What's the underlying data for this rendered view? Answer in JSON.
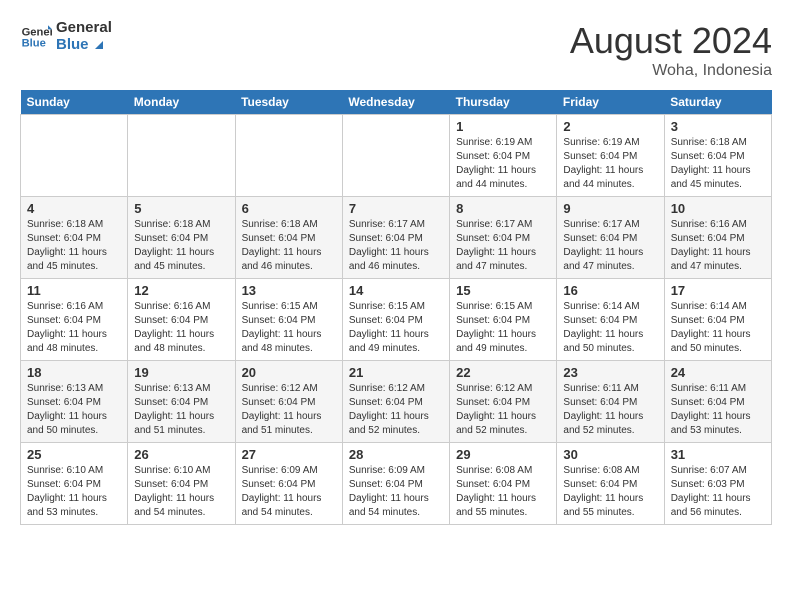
{
  "header": {
    "logo_line1": "General",
    "logo_line2": "Blue",
    "month": "August 2024",
    "location": "Woha, Indonesia"
  },
  "weekdays": [
    "Sunday",
    "Monday",
    "Tuesday",
    "Wednesday",
    "Thursday",
    "Friday",
    "Saturday"
  ],
  "weeks": [
    [
      {
        "day": "",
        "info": ""
      },
      {
        "day": "",
        "info": ""
      },
      {
        "day": "",
        "info": ""
      },
      {
        "day": "",
        "info": ""
      },
      {
        "day": "1",
        "info": "Sunrise: 6:19 AM\nSunset: 6:04 PM\nDaylight: 11 hours\nand 44 minutes."
      },
      {
        "day": "2",
        "info": "Sunrise: 6:19 AM\nSunset: 6:04 PM\nDaylight: 11 hours\nand 44 minutes."
      },
      {
        "day": "3",
        "info": "Sunrise: 6:18 AM\nSunset: 6:04 PM\nDaylight: 11 hours\nand 45 minutes."
      }
    ],
    [
      {
        "day": "4",
        "info": "Sunrise: 6:18 AM\nSunset: 6:04 PM\nDaylight: 11 hours\nand 45 minutes."
      },
      {
        "day": "5",
        "info": "Sunrise: 6:18 AM\nSunset: 6:04 PM\nDaylight: 11 hours\nand 45 minutes."
      },
      {
        "day": "6",
        "info": "Sunrise: 6:18 AM\nSunset: 6:04 PM\nDaylight: 11 hours\nand 46 minutes."
      },
      {
        "day": "7",
        "info": "Sunrise: 6:17 AM\nSunset: 6:04 PM\nDaylight: 11 hours\nand 46 minutes."
      },
      {
        "day": "8",
        "info": "Sunrise: 6:17 AM\nSunset: 6:04 PM\nDaylight: 11 hours\nand 47 minutes."
      },
      {
        "day": "9",
        "info": "Sunrise: 6:17 AM\nSunset: 6:04 PM\nDaylight: 11 hours\nand 47 minutes."
      },
      {
        "day": "10",
        "info": "Sunrise: 6:16 AM\nSunset: 6:04 PM\nDaylight: 11 hours\nand 47 minutes."
      }
    ],
    [
      {
        "day": "11",
        "info": "Sunrise: 6:16 AM\nSunset: 6:04 PM\nDaylight: 11 hours\nand 48 minutes."
      },
      {
        "day": "12",
        "info": "Sunrise: 6:16 AM\nSunset: 6:04 PM\nDaylight: 11 hours\nand 48 minutes."
      },
      {
        "day": "13",
        "info": "Sunrise: 6:15 AM\nSunset: 6:04 PM\nDaylight: 11 hours\nand 48 minutes."
      },
      {
        "day": "14",
        "info": "Sunrise: 6:15 AM\nSunset: 6:04 PM\nDaylight: 11 hours\nand 49 minutes."
      },
      {
        "day": "15",
        "info": "Sunrise: 6:15 AM\nSunset: 6:04 PM\nDaylight: 11 hours\nand 49 minutes."
      },
      {
        "day": "16",
        "info": "Sunrise: 6:14 AM\nSunset: 6:04 PM\nDaylight: 11 hours\nand 50 minutes."
      },
      {
        "day": "17",
        "info": "Sunrise: 6:14 AM\nSunset: 6:04 PM\nDaylight: 11 hours\nand 50 minutes."
      }
    ],
    [
      {
        "day": "18",
        "info": "Sunrise: 6:13 AM\nSunset: 6:04 PM\nDaylight: 11 hours\nand 50 minutes."
      },
      {
        "day": "19",
        "info": "Sunrise: 6:13 AM\nSunset: 6:04 PM\nDaylight: 11 hours\nand 51 minutes."
      },
      {
        "day": "20",
        "info": "Sunrise: 6:12 AM\nSunset: 6:04 PM\nDaylight: 11 hours\nand 51 minutes."
      },
      {
        "day": "21",
        "info": "Sunrise: 6:12 AM\nSunset: 6:04 PM\nDaylight: 11 hours\nand 52 minutes."
      },
      {
        "day": "22",
        "info": "Sunrise: 6:12 AM\nSunset: 6:04 PM\nDaylight: 11 hours\nand 52 minutes."
      },
      {
        "day": "23",
        "info": "Sunrise: 6:11 AM\nSunset: 6:04 PM\nDaylight: 11 hours\nand 52 minutes."
      },
      {
        "day": "24",
        "info": "Sunrise: 6:11 AM\nSunset: 6:04 PM\nDaylight: 11 hours\nand 53 minutes."
      }
    ],
    [
      {
        "day": "25",
        "info": "Sunrise: 6:10 AM\nSunset: 6:04 PM\nDaylight: 11 hours\nand 53 minutes."
      },
      {
        "day": "26",
        "info": "Sunrise: 6:10 AM\nSunset: 6:04 PM\nDaylight: 11 hours\nand 54 minutes."
      },
      {
        "day": "27",
        "info": "Sunrise: 6:09 AM\nSunset: 6:04 PM\nDaylight: 11 hours\nand 54 minutes."
      },
      {
        "day": "28",
        "info": "Sunrise: 6:09 AM\nSunset: 6:04 PM\nDaylight: 11 hours\nand 54 minutes."
      },
      {
        "day": "29",
        "info": "Sunrise: 6:08 AM\nSunset: 6:04 PM\nDaylight: 11 hours\nand 55 minutes."
      },
      {
        "day": "30",
        "info": "Sunrise: 6:08 AM\nSunset: 6:04 PM\nDaylight: 11 hours\nand 55 minutes."
      },
      {
        "day": "31",
        "info": "Sunrise: 6:07 AM\nSunset: 6:03 PM\nDaylight: 11 hours\nand 56 minutes."
      }
    ]
  ]
}
